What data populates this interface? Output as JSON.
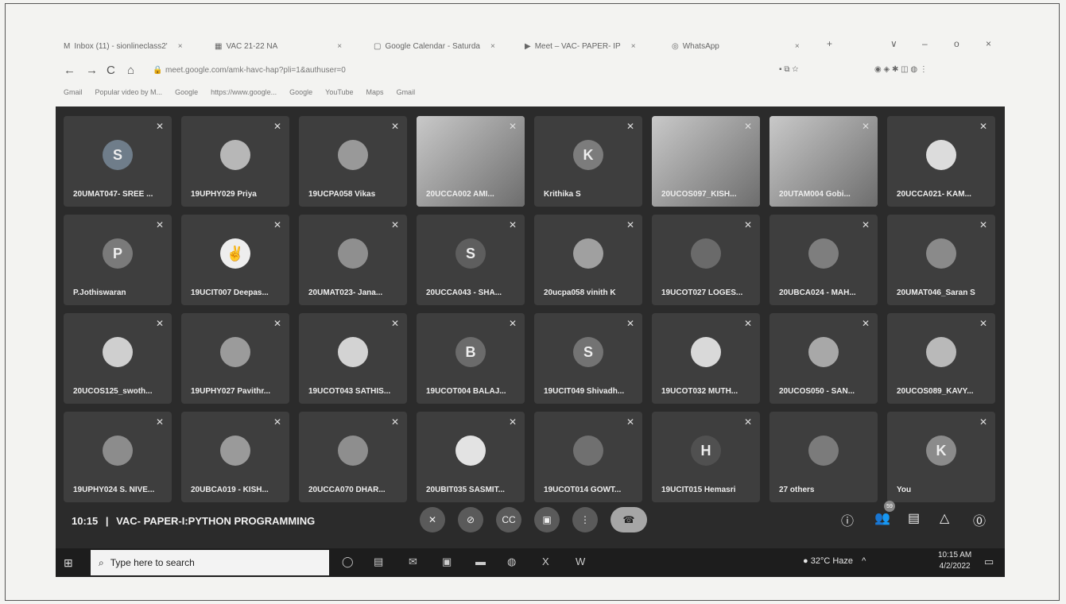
{
  "browser": {
    "tabs": [
      {
        "icon": "M",
        "label": "Inbox (11) - sionlineclass2'",
        "close": "×"
      },
      {
        "icon": "▦",
        "label": "VAC 21-22 NA",
        "close": "×"
      },
      {
        "icon": "▢",
        "label": "Google Calendar - Saturda",
        "close": "×"
      },
      {
        "icon": "▶",
        "label": "Meet – VAC- PAPER- IP",
        "close": "×"
      },
      {
        "icon": "◎",
        "label": "WhatsApp",
        "close": "×"
      }
    ],
    "new_tab": "+",
    "window_controls": [
      "∨",
      "–",
      "o",
      "×"
    ],
    "url": "meet.google.com/amk-havc-hap?pli=1&authuser=0",
    "bookmarks": [
      "Gmail",
      "Popular video by M...",
      "Google",
      "https://www.google...",
      "Google",
      "YouTube",
      "Maps",
      "Gmail"
    ]
  },
  "participants": [
    {
      "initial": "S",
      "name": "20UMAT047- SREE ...",
      "type": "letter",
      "color": "#6f7d8a"
    },
    {
      "initial": "",
      "name": "19UPHY029 Priya",
      "type": "photo",
      "color": "#b7b7b7"
    },
    {
      "initial": "",
      "name": "19UCPA058 Vikas",
      "type": "photo",
      "color": "#999999"
    },
    {
      "initial": "",
      "name": "20UCCA002 AMI...",
      "type": "video",
      "color": "#bfbfbf"
    },
    {
      "initial": "K",
      "name": "Krithika S",
      "type": "letter",
      "color": "#7c7c7c"
    },
    {
      "initial": "",
      "name": "20UCOS097_KISH...",
      "type": "video",
      "color": "#9a9a9a"
    },
    {
      "initial": "",
      "name": "20UTAM004 Gobi...",
      "type": "video",
      "color": "#6e6e6e"
    },
    {
      "initial": "",
      "name": "20UCCA021- KAM...",
      "type": "photo",
      "color": "#dcdcdc"
    },
    {
      "initial": "P",
      "name": "P.Jothiswaran",
      "type": "letter",
      "color": "#7a7a7a"
    },
    {
      "initial": "✌",
      "name": "19UCIT007 Deepas...",
      "type": "photo",
      "color": "#eeeeee"
    },
    {
      "initial": "",
      "name": "20UMAT023- Jana...",
      "type": "photo",
      "color": "#8f8f8f"
    },
    {
      "initial": "S",
      "name": "20UCCA043 - SHA...",
      "type": "letter",
      "color": "#5e5e5e"
    },
    {
      "initial": "",
      "name": "20ucpa058 vinith K",
      "type": "photo",
      "color": "#a0a0a0"
    },
    {
      "initial": "",
      "name": "19UCOT027 LOGES...",
      "type": "photo",
      "color": "#6a6a6a"
    },
    {
      "initial": "",
      "name": "20UBCA024 - MAH...",
      "type": "photo",
      "color": "#7e7e7e"
    },
    {
      "initial": "",
      "name": "20UMAT046_Saran S",
      "type": "photo",
      "color": "#8a8a8a"
    },
    {
      "initial": "",
      "name": "20UCOS125_swoth...",
      "type": "photo",
      "color": "#cfcfcf"
    },
    {
      "initial": "",
      "name": "19UPHY027 Pavithr...",
      "type": "photo",
      "color": "#9b9b9b"
    },
    {
      "initial": "",
      "name": "19UCOT043 SATHIS...",
      "type": "photo",
      "color": "#d3d3d3"
    },
    {
      "initial": "B",
      "name": "19UCOT004 BALAJ...",
      "type": "letter",
      "color": "#6b6b6b"
    },
    {
      "initial": "S",
      "name": "19UCIT049 Shivadh...",
      "type": "letter",
      "color": "#737373"
    },
    {
      "initial": "",
      "name": "19UCOT032 MUTH...",
      "type": "photo",
      "color": "#d9d9d9"
    },
    {
      "initial": "",
      "name": "20UCOS050 - SAN...",
      "type": "photo",
      "color": "#a8a8a8"
    },
    {
      "initial": "",
      "name": "20UCOS089_KAVY...",
      "type": "photo",
      "color": "#b9b9b9"
    },
    {
      "initial": "",
      "name": "19UPHY024 S. NIVE...",
      "type": "photo",
      "color": "#8c8c8c"
    },
    {
      "initial": "",
      "name": "20UBCA019 - KISH...",
      "type": "photo",
      "color": "#9a9a9a"
    },
    {
      "initial": "",
      "name": "20UCCA070 DHAR...",
      "type": "photo",
      "color": "#8e8e8e"
    },
    {
      "initial": "",
      "name": "20UBIT035 SASMIT...",
      "type": "photo",
      "color": "#e3e3e3"
    },
    {
      "initial": "",
      "name": "19UCOT014 GOWT...",
      "type": "photo",
      "color": "#707070"
    },
    {
      "initial": "H",
      "name": "19UCIT015 Hemasri",
      "type": "letter",
      "color": "#505050"
    },
    {
      "initial": "",
      "name": "27 others",
      "type": "others",
      "color": "#7b7b7b"
    },
    {
      "initial": "K",
      "name": "You",
      "type": "letter",
      "color": "#8b8b8b"
    }
  ],
  "mic_muted_icon": "✕",
  "meeting": {
    "time": "10:15",
    "separator": "|",
    "title": "VAC- PAPER-I:PYTHON PROGRAMMING"
  },
  "controls": {
    "mic": "✕",
    "camera": "⊘",
    "captions": "CC",
    "present": "▣",
    "more": "⋮",
    "end": "☎"
  },
  "right_controls": {
    "info": "ⓘ",
    "people": "👥",
    "people_count": "59",
    "chat": "▤",
    "activities": "△",
    "safety": "⓪"
  },
  "taskbar": {
    "start": "⊞",
    "search_icon": "⌕",
    "search_placeholder": "Type here to search",
    "weather": "32°C Haze",
    "time": "10:15 AM",
    "date": "4/2/2022"
  }
}
